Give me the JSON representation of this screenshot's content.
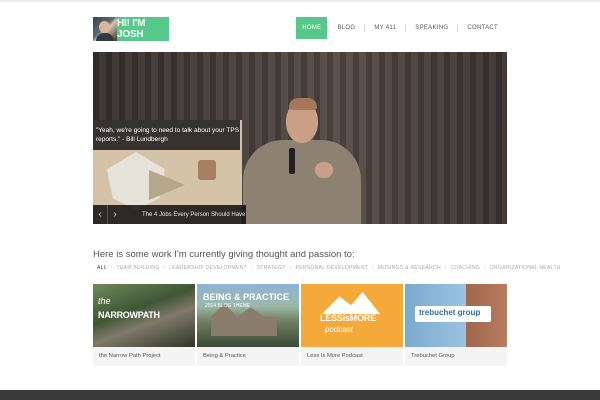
{
  "header": {
    "logo_text": "HI! I'M JOSH",
    "nav": [
      {
        "label": "HOME",
        "active": true
      },
      {
        "label": "BLOG"
      },
      {
        "label": "MY 411"
      },
      {
        "label": "SPEAKING"
      },
      {
        "label": "CONTACT"
      }
    ]
  },
  "hero": {
    "quote": "\"Yeah, we're going to need to talk about your TPS reports.\" - Bill Lundbergh",
    "slide_title": "The 4 Jobs Every Person Should Have",
    "prev_icon": "‹",
    "next_icon": "›"
  },
  "work": {
    "heading": "Here is some work I'm currently giving thought and passion to:",
    "filters": [
      "ALL",
      "TEAM BUILDING",
      "LEADERSHIP DEVELOPMENT",
      "STRATEGY",
      "PERSONAL DEVELOPMENT",
      "MUSINGS & RESEARCH",
      "COACHING",
      "ORGANIZATIONAL HEALTH"
    ],
    "projects": [
      {
        "label": "the Narrow Path Project",
        "thumb_line1": "the",
        "thumb_line2": "NARROWPATH"
      },
      {
        "label": "Being & Practice",
        "thumb_line1": "BEING & PRACTICE",
        "thumb_line2": "2014 BLOG THEME"
      },
      {
        "label": "Less Is More Podcast",
        "thumb_line1": "LESSisMORE",
        "thumb_line2": "podcast"
      },
      {
        "label": "Trebuchet Group",
        "thumb_line1": "trebuchet group"
      }
    ]
  },
  "colors": {
    "accent": "#55c98a",
    "footer": "#3a3a3a"
  }
}
